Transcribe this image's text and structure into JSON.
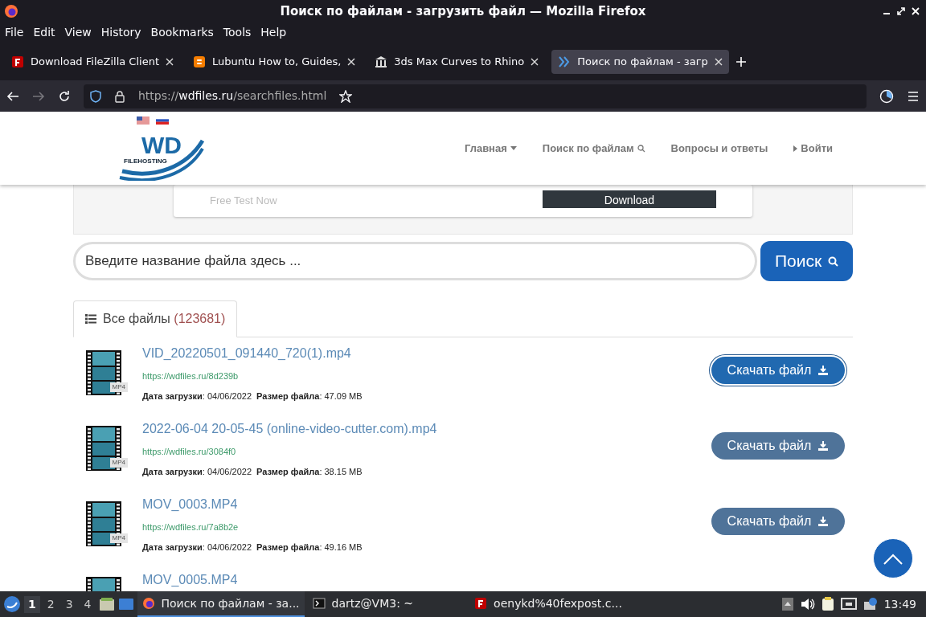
{
  "window": {
    "title": "Поиск по файлам - загрузить файл — Mozilla Firefox"
  },
  "menu": [
    "File",
    "Edit",
    "View",
    "History",
    "Bookmarks",
    "Tools",
    "Help"
  ],
  "tabs": [
    {
      "label": "Download FileZilla Client",
      "kind": "filezilla",
      "selected": false
    },
    {
      "label": "Lubuntu How to, Guides,",
      "kind": "blog",
      "selected": false
    },
    {
      "label": "3ds Max Curves to Rhino",
      "kind": "museum",
      "selected": false
    },
    {
      "label": "Поиск по файлам - загр",
      "kind": "chevrons",
      "selected": true
    }
  ],
  "address": {
    "scheme": "https://",
    "host": "wdfiles.ru",
    "path": "/searchfiles.html"
  },
  "site": {
    "logo": {
      "main": "WD",
      "sub": "FILEHOSTING"
    },
    "nav": [
      {
        "label": "Главная",
        "kind": "caret"
      },
      {
        "label": "Поиск по файлам",
        "kind": "search"
      },
      {
        "label": "Вопросы и ответы",
        "kind": "none"
      },
      {
        "label": "Войти",
        "kind": "arrow"
      }
    ],
    "ad": {
      "text": "Free Test Now",
      "button": "Download"
    },
    "search": {
      "placeholder": "Введите название файла здесь ...",
      "button": "Поиск"
    },
    "files_tab": {
      "label": "Все файлы",
      "count": "(123681)",
      "selected": true
    },
    "files": [
      {
        "name": "VID_20220501_091440_720(1).mp4",
        "type": "MP4",
        "url": "https://wdfiles.ru/8d239b",
        "meta": "**Дата загрузки**: 04/06/2022  **Размер файла**: 47.09 MB",
        "button": "Скачать файл",
        "focused": true
      },
      {
        "name": "2022-06-04 20-05-45 (online-video-cutter.com).mp4",
        "type": "MP4",
        "url": "https://wdfiles.ru/3084f0",
        "meta": "**Дата загрузки**: 04/06/2022  **Размер файла**: 38.15 MB",
        "button": "Скачать файл",
        "focused": false
      },
      {
        "name": "MOV_0003.MP4",
        "type": "MP4",
        "url": "https://wdfiles.ru/7a8b2e",
        "meta": "**Дата загрузки**: 04/06/2022  **Размер файла**: 49.16 MB",
        "button": "Скачать файл",
        "focused": false
      },
      {
        "name": "MOV_0005.MP4"
      }
    ]
  },
  "taskbar": {
    "workspaces": [
      {
        "label": "1",
        "selected": true
      },
      {
        "label": "2",
        "selected": false
      },
      {
        "label": "3",
        "selected": false
      },
      {
        "label": "4",
        "selected": false
      }
    ],
    "windows": [
      {
        "label": "Поиск по файлам - за...",
        "kind": "firefox",
        "selected": true
      },
      {
        "label": "dartz@VM3: ~",
        "kind": "terminal",
        "selected": false
      },
      {
        "label": "oenykd%40fexpost.c...",
        "kind": "filezilla",
        "selected": false
      }
    ],
    "clock": "13:49"
  }
}
